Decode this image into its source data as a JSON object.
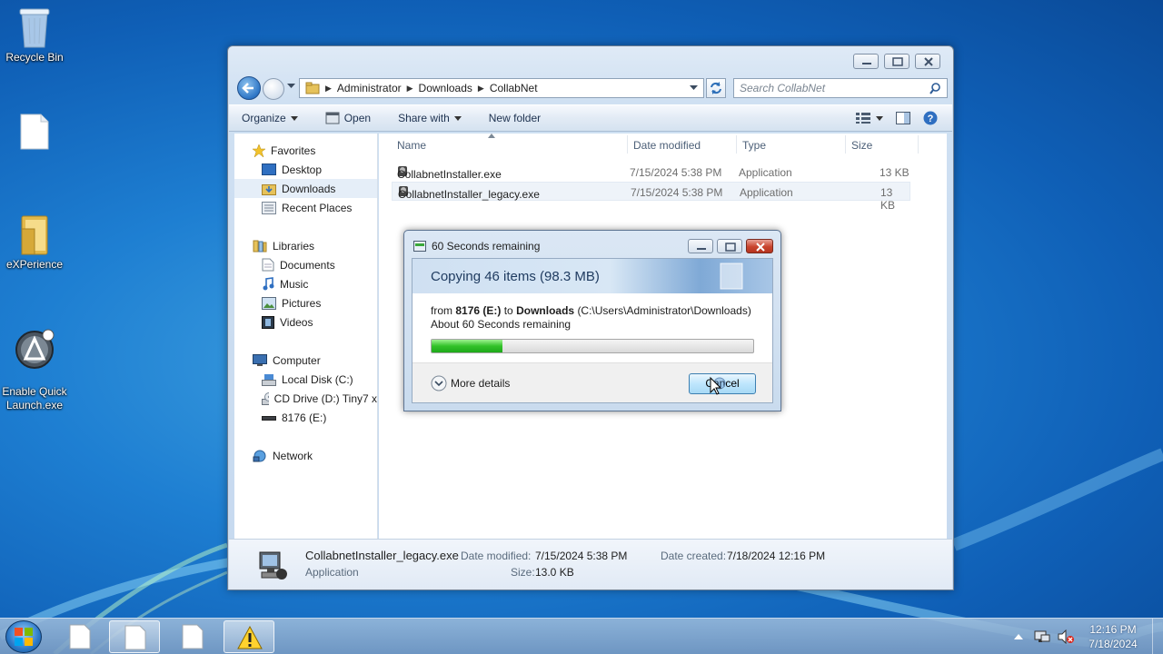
{
  "desktop": {
    "icons": [
      {
        "label": "Recycle Bin"
      },
      {
        "label": ""
      },
      {
        "label": "eXPerience"
      },
      {
        "label": "Enable Quick\nLaunch.exe"
      }
    ]
  },
  "explorer": {
    "breadcrumb": [
      "Administrator",
      "Downloads",
      "CollabNet"
    ],
    "search_placeholder": "Search CollabNet",
    "commands": {
      "organize": "Organize",
      "open": "Open",
      "share_with": "Share with",
      "new_folder": "New folder"
    },
    "nav": {
      "favorites": "Favorites",
      "desktop": "Desktop",
      "downloads": "Downloads",
      "recent_places": "Recent Places",
      "libraries": "Libraries",
      "documents": "Documents",
      "music": "Music",
      "pictures": "Pictures",
      "videos": "Videos",
      "computer": "Computer",
      "local_disk": "Local Disk (C:)",
      "cd_drive": "CD Drive (D:) Tiny7 x",
      "usb_drive": "8176 (E:)",
      "network": "Network"
    },
    "columns": {
      "name": "Name",
      "date": "Date modified",
      "type": "Type",
      "size": "Size"
    },
    "files": [
      {
        "name": "CollabnetInstaller.exe",
        "date": "7/15/2024 5:38 PM",
        "type": "Application",
        "size": "13 KB"
      },
      {
        "name": "CollabnetInstaller_legacy.exe",
        "date": "7/15/2024 5:38 PM",
        "type": "Application",
        "size": "13 KB"
      }
    ],
    "details": {
      "name": "CollabnetInstaller_legacy.exe",
      "type": "Application",
      "modified_label": "Date modified:",
      "modified": "7/15/2024 5:38 PM",
      "size_label": "Size:",
      "size": "13.0 KB",
      "created_label": "Date created:",
      "created": "7/18/2024 12:16 PM"
    }
  },
  "copy_dialog": {
    "title": "60 Seconds remaining",
    "header": "Copying 46 items (98.3 MB)",
    "from_word": "from",
    "source": "8176 (E:)",
    "to_word": "to",
    "dest": "Downloads",
    "dest_path": "(C:\\Users\\Administrator\\Downloads)",
    "remaining": "About 60 Seconds remaining",
    "progress": 0.22,
    "more_details": "More details",
    "cancel": "Cancel"
  },
  "taskbar": {
    "time": "12:16 PM",
    "date": "7/18/2024"
  }
}
